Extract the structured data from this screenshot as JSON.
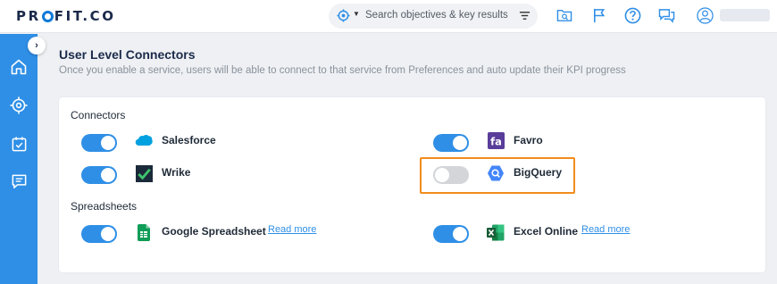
{
  "app": {
    "logo": "PROFIT.CO"
  },
  "search": {
    "placeholder": "Search objectives & key results"
  },
  "page": {
    "title": "User Level Connectors",
    "subtitle": "Once you enable a service, users will be able to connect to that service from Preferences and auto update their KPI progress"
  },
  "sections": {
    "connectors_label": "Connectors",
    "spreadsheets_label": "Spreadsheets"
  },
  "services": {
    "salesforce": {
      "name": "Salesforce",
      "enabled": true
    },
    "favro": {
      "name": "Favro",
      "enabled": true
    },
    "wrike": {
      "name": "Wrike",
      "enabled": true
    },
    "bigquery": {
      "name": "BigQuery",
      "enabled": false
    },
    "google_spreadsheet": {
      "name": "Google Spreadsheet",
      "enabled": true,
      "link": "Read more"
    },
    "excel_online": {
      "name": "Excel Online",
      "enabled": true,
      "link": "Read more"
    }
  },
  "colors": {
    "accent": "#2f8fe6",
    "highlight": "#f28c1c",
    "toggle_off": "#d3d5d9"
  }
}
